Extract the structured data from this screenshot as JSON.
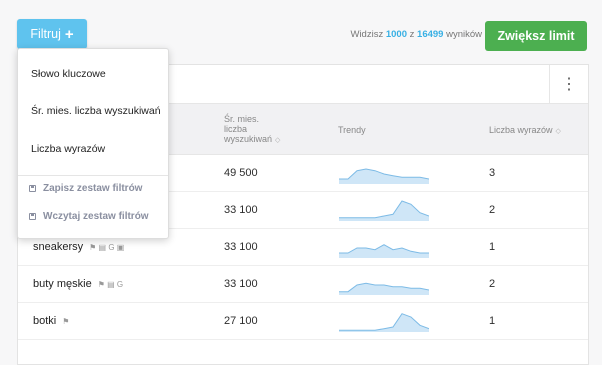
{
  "toolbar": {
    "filter_label": "Filtruj",
    "filter_plus": "+",
    "count_prefix": "Widzisz",
    "shown": "1000",
    "count_mid": "z",
    "total": "16499",
    "count_suffix": "wyników",
    "limit_label": "Zwiększ limit"
  },
  "dropdown": {
    "items": [
      "Słowo kluczowe",
      "Śr. mies. liczba wyszukiwań",
      "Liczba wyrazów"
    ],
    "actions": [
      "Zapisz zestaw filtrów",
      "Wczytaj zestaw filtrów"
    ]
  },
  "menu_icon": "⋮",
  "table": {
    "headers": {
      "volume": [
        "Śr. mies.",
        "liczba",
        "wyszukiwań"
      ],
      "trend": "Trendy",
      "words": "Liczba wyrazów",
      "sort_icon": "◇"
    },
    "rows": [
      {
        "keyword": "",
        "features": "",
        "volume": "49 500",
        "words": "3",
        "trend": [
          3,
          3,
          8,
          9,
          8,
          6,
          5,
          4,
          4,
          4,
          3
        ]
      },
      {
        "keyword": "",
        "features": "",
        "volume": "33 100",
        "words": "2",
        "trend": [
          2,
          2,
          2,
          2,
          2,
          3,
          4,
          12,
          10,
          5,
          3
        ]
      },
      {
        "keyword": "sneakersy",
        "features": "⚑ ▤ G ▣",
        "volume": "33 100",
        "words": "1",
        "trend": [
          3,
          3,
          6,
          6,
          5,
          8,
          5,
          6,
          4,
          3,
          3
        ]
      },
      {
        "keyword": "buty męskie",
        "features": "⚑ ▤ G",
        "volume": "33 100",
        "words": "2",
        "trend": [
          2,
          2,
          6,
          7,
          6,
          6,
          5,
          5,
          4,
          4,
          3
        ]
      },
      {
        "keyword": "botki",
        "features": "⚑",
        "volume": "27 100",
        "words": "1",
        "trend": [
          1,
          1,
          1,
          1,
          1,
          2,
          3,
          11,
          9,
          4,
          2
        ]
      }
    ]
  },
  "colors": {
    "accent": "#5fc3ee",
    "cta": "#4caf50",
    "trend_fill": "#cfe6f7",
    "trend_line": "#7dbbe6"
  }
}
